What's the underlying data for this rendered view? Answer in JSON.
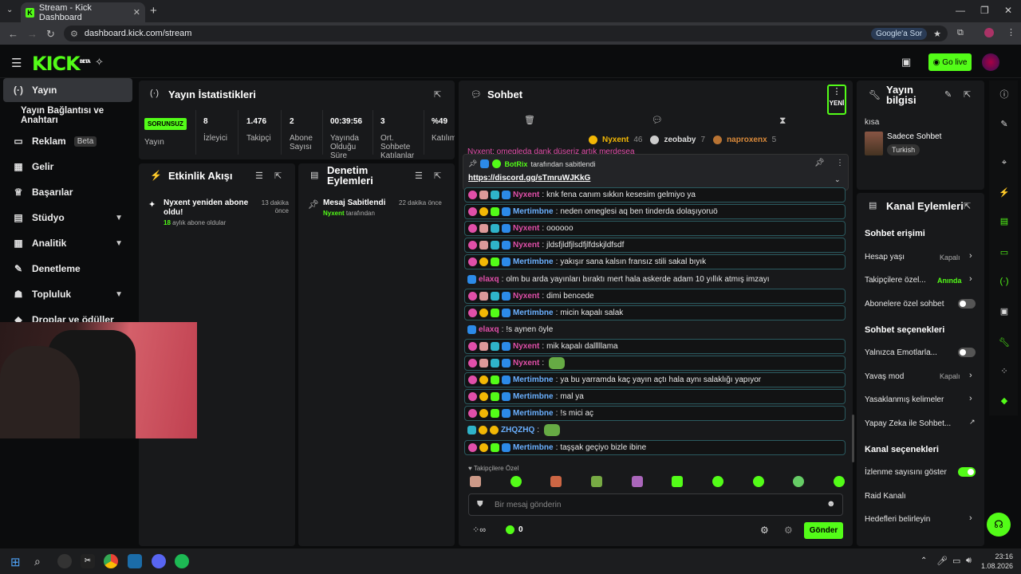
{
  "browser": {
    "tab_title": "Stream - Kick Dashboard",
    "url": "dashboard.kick.com/stream",
    "google_btn": "Google'a Sor"
  },
  "header": {
    "logo": "KICK",
    "logo_sup": "BETA",
    "go_live": "Go live"
  },
  "sidebar": {
    "items": [
      {
        "label": "Yayın",
        "icon": "broadcast-icon"
      },
      {
        "label": "Yayın Bağlantısı ve Anahtarı",
        "icon": ""
      },
      {
        "label": "Reklam",
        "badge": "Beta",
        "icon": "ad-icon"
      },
      {
        "label": "Gelir",
        "icon": "revenue-icon"
      },
      {
        "label": "Başarılar",
        "icon": "trophy-icon"
      },
      {
        "label": "Stüdyo",
        "icon": "studio-icon"
      },
      {
        "label": "Analitik",
        "icon": "analytics-icon"
      },
      {
        "label": "Denetleme",
        "icon": "moderation-icon"
      },
      {
        "label": "Topluluk",
        "icon": "community-icon"
      },
      {
        "label": "Droplar ve ödüller",
        "icon": "drops-icon"
      }
    ]
  },
  "stats": {
    "title": "Yayın İstatistikleri",
    "status": "SORUNSUZ",
    "status_label": "Yayın",
    "items": [
      {
        "value": "8",
        "label": "İzleyici"
      },
      {
        "value": "1.476",
        "label": "Takipçi"
      },
      {
        "value": "2",
        "label": "Abone Sayısı"
      },
      {
        "value": "00:39:56",
        "label": "Yayında Olduğu Süre"
      },
      {
        "value": "3",
        "label": "Ort. Sohbete Katılanlar"
      },
      {
        "value": "%49",
        "label": "Katılım"
      }
    ]
  },
  "activity": {
    "title": "Etkinlik Akışı",
    "event_title": "Nyxent yeniden abone oldu!",
    "months": "18",
    "event_sub": "aylık abone oldular",
    "time": "13 dakika önce"
  },
  "modactions": {
    "title": "Denetim Eylemleri",
    "action": "Mesaj Sabitlendi",
    "by_user": "Nyxent",
    "by_text": "tarafından",
    "time": "22 dakika önce"
  },
  "chat": {
    "title": "Sohbet",
    "new_label": "YENİ",
    "leaders": [
      {
        "name": "Nyxent",
        "count": "46"
      },
      {
        "name": "zeobaby",
        "count": "7"
      },
      {
        "name": "naproxenx",
        "count": "5"
      }
    ],
    "pinned_by": "BotRix",
    "pinned_by_text": "tarafından sabitlendi",
    "pinned_link": "https://discord.gg/sTmruWJKkG",
    "overflow_text": "Nyxent: omegleda dank düşeriz artık merdesea",
    "messages": [
      {
        "user": "Nyxent",
        "text": "knk fena canım sıkkın kesesim gelmiyo ya",
        "type": "nyx"
      },
      {
        "user": "Mertimbne",
        "text": "neden omeglesi aq ben tinderda dolaşıyoruö",
        "type": "mer"
      },
      {
        "user": "Nyxent",
        "text": "oooooo",
        "type": "nyx"
      },
      {
        "user": "Nyxent",
        "text": "jldsfjldfjlsdfjlfdskjldfsdf",
        "type": "nyx"
      },
      {
        "user": "Mertimbne",
        "text": "yakışır sana kalsın fransız stili sakal bıyık",
        "type": "mer"
      },
      {
        "user": "elaxq",
        "text": "olm bu arda yayınları bıraktı mert hala askerde adam 10 yıllık atmış imzayı",
        "type": "ela"
      },
      {
        "user": "Nyxent",
        "text": "dimi bencede",
        "type": "nyx"
      },
      {
        "user": "Mertimbne",
        "text": "micin kapalı salak",
        "type": "mer"
      },
      {
        "user": "elaxq",
        "text": "!s aynen öyle",
        "type": "ela"
      },
      {
        "user": "Nyxent",
        "text": "mik kapalı dalllllama",
        "type": "nyx"
      },
      {
        "user": "Nyxent",
        "text": "",
        "type": "nyx",
        "emote": true
      },
      {
        "user": "Mertimbne",
        "text": "ya bu yarramda kaç yayın açtı hala aynı salaklığı yapıyor",
        "type": "mer"
      },
      {
        "user": "Mertimbne",
        "text": "mal ya",
        "type": "mer"
      },
      {
        "user": "Mertimbne",
        "text": "!s mici aç",
        "type": "mer"
      },
      {
        "user": "ZHQZHQ",
        "text": "",
        "type": "zh",
        "emote": true
      },
      {
        "user": "Mertimbne",
        "text": "taşşak geçiyo bizle ibine",
        "type": "mer"
      }
    ],
    "followers_only": "Takipçilere Özel",
    "input_placeholder": "Bir mesaj gönderin",
    "points": "0",
    "send": "Gönder"
  },
  "info": {
    "title": "Yayın bilgisi",
    "title_value": "kısa",
    "category": "Sadece Sohbet",
    "tag": "Turkish"
  },
  "channel": {
    "title": "Kanal Eylemleri",
    "sec1": "Sohbet erişimi",
    "account_age": "Hesap yaşı",
    "account_age_val": "Kapalı",
    "followers": "Takipçilere özel...",
    "followers_val": "Anında",
    "subs": "Abonelere özel sohbet",
    "sec2": "Sohbet seçenekleri",
    "emotes": "Yalnızca Emotlarla...",
    "slow": "Yavaş mod",
    "slow_val": "Kapalı",
    "banned": "Yasaklanmış kelimeler",
    "ai": "Yapay Zeka ile Sohbet...",
    "sec3": "Kanal seçenekleri",
    "viewcount": "İzlenme sayısını göster",
    "raid": "Raid Kanalı",
    "goals": "Hedefleri belirleyin"
  },
  "taskbar": {
    "time": "23:16",
    "date": "1.08.2026"
  }
}
